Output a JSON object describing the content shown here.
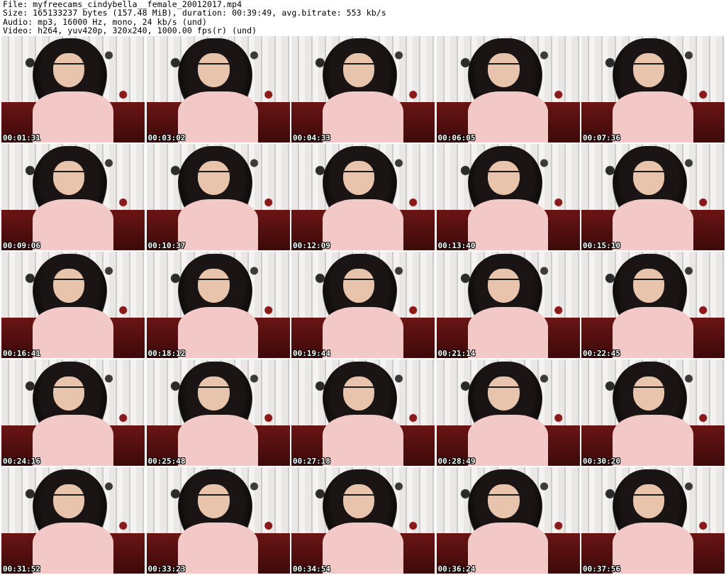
{
  "header": {
    "line1": "File: myfreecams_cindybella__female_20012017.mp4",
    "line2": "Size: 165133237 bytes (157.48 MiB), duration: 00:39:49, avg.bitrate: 553 kb/s",
    "line3": "Audio: mp3, 16000 Hz, mono, 24 kb/s (und)",
    "line4": "Video: h264, yuv420p, 320x240, 1000.00 fps(r) (und)"
  },
  "thumbnails": [
    {
      "time": "00:01:31"
    },
    {
      "time": "00:03:02"
    },
    {
      "time": "00:04:33"
    },
    {
      "time": "00:06:05"
    },
    {
      "time": "00:07:36"
    },
    {
      "time": "00:09:06"
    },
    {
      "time": "00:10:37"
    },
    {
      "time": "00:12:09"
    },
    {
      "time": "00:13:40"
    },
    {
      "time": "00:15:10"
    },
    {
      "time": "00:16:41"
    },
    {
      "time": "00:18:12"
    },
    {
      "time": "00:19:44"
    },
    {
      "time": "00:21:14"
    },
    {
      "time": "00:22:45"
    },
    {
      "time": "00:24:16"
    },
    {
      "time": "00:25:48"
    },
    {
      "time": "00:27:18"
    },
    {
      "time": "00:28:49"
    },
    {
      "time": "00:30:20"
    },
    {
      "time": "00:31:52"
    },
    {
      "time": "00:33:23"
    },
    {
      "time": "00:34:54"
    },
    {
      "time": "00:36:24"
    },
    {
      "time": "00:37:56"
    }
  ]
}
